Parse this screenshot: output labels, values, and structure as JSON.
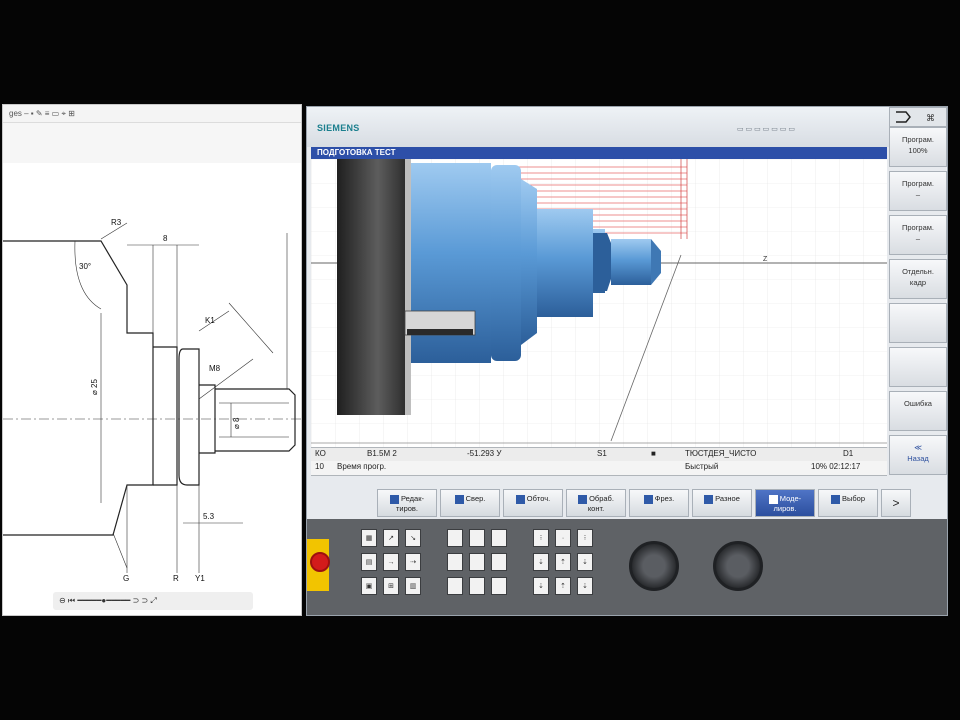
{
  "drawing_viewer": {
    "toolbar_text": "ges  –  ▪  ✎  ≡  ▭  ⌖  ⊞",
    "dims": {
      "r_top": "R3",
      "angle": "30°",
      "top_width": "8",
      "chamfer": "K1",
      "thread": "M8",
      "dia_left": "⌀ 25",
      "dia_mid": "⌀ 8",
      "small_len": "5.3",
      "bottom_a": "G",
      "bottom_b": "R",
      "bottom_c": "Y1"
    },
    "page_nav": "⊖   ⏮   ━━━━━●━━━━━   ⊃   ⊃   ⤢"
  },
  "cnc": {
    "brand": "SIEMENS",
    "top_right_status": "▭ ▭ ▭ ▭ ▭ ▭ ▭",
    "mode_title": "ПОДГОТОВКА ТЕСТ",
    "status_row1": {
      "c1": "КО",
      "c2": "В1.5М 2",
      "c3": "-51.293 У",
      "c4": "S1",
      "c5": "■",
      "c6": "ТЮСТДЕЯ_ЧИСТО",
      "c7": "D1"
    },
    "status_row2": {
      "c1": "10",
      "c2": "Время прогр.",
      "c6": "Быстрый",
      "c7": "10% 02:12:17"
    },
    "vertical_softkeys": [
      {
        "label": "Програм.\n100%"
      },
      {
        "label": "Програм.\n–"
      },
      {
        "label": "Програм.\n–"
      },
      {
        "label": "Отдельн.\nкадр"
      },
      {
        "label": ""
      },
      {
        "label": ""
      },
      {
        "label": "Ошибка"
      },
      {
        "label": "≪\nНазад"
      }
    ],
    "horizontal_softkeys": [
      {
        "label": "Редак-\nтиров.",
        "active": false
      },
      {
        "label": "Свер.",
        "active": false
      },
      {
        "label": "Обточ.",
        "active": false
      },
      {
        "label": "Обраб.\nконт.",
        "active": false
      },
      {
        "label": "Фрез.",
        "active": false
      },
      {
        "label": "Разное",
        "active": false
      },
      {
        "label": "Моде-\nлиров.",
        "active": true
      },
      {
        "label": "Выбор",
        "active": false
      }
    ],
    "next_key": ">"
  }
}
